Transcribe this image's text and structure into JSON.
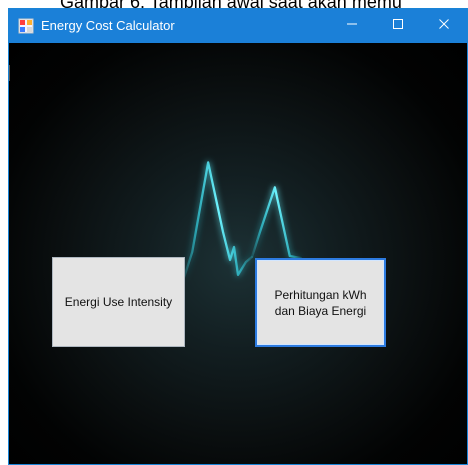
{
  "document": {
    "top_text": "Gambar 6. Tampilan awal saat akan memu"
  },
  "window": {
    "title": "Energy Cost Calculator",
    "controls": {
      "minimize_icon": "minimize-icon",
      "maximize_icon": "maximize-icon",
      "close_icon": "close-icon"
    }
  },
  "main": {
    "background": {
      "pulse_color": "#34d7e8"
    },
    "buttons": {
      "energy_use_intensity": "Energi Use Intensity",
      "kwh_cost": "Perhitungan kWh dan Biaya Energi"
    }
  },
  "colors": {
    "titlebar": "#1b80d8",
    "button_face": "#e4e4e4",
    "focused_border": "#2d7be0"
  }
}
